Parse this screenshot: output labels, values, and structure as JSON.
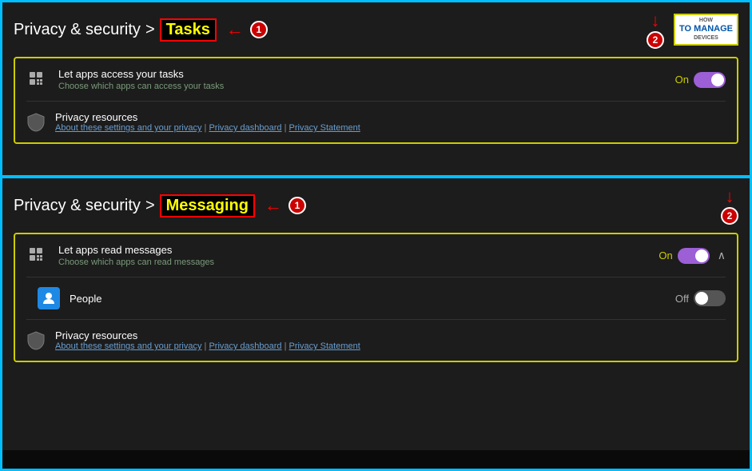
{
  "section1": {
    "breadcrumb": "Privacy & security",
    "sep": ">",
    "title": "Tasks",
    "badge1_label": "1",
    "badge2_label": "2",
    "setting": {
      "title": "Let apps access your tasks",
      "subtitle": "Choose which apps can access your tasks",
      "toggle_label": "On",
      "toggle_state": "on"
    },
    "privacy": {
      "title": "Privacy resources",
      "subtitle_about": "About these settings and your privacy",
      "subtitle_dashboard": "Privacy dashboard",
      "subtitle_statement": "Privacy Statement"
    }
  },
  "section2": {
    "breadcrumb": "Privacy & security",
    "sep": ">",
    "title": "Messaging",
    "badge1_label": "1",
    "badge2_label": "2",
    "setting": {
      "title": "Let apps read messages",
      "subtitle": "Choose which apps can read messages",
      "toggle_label": "On",
      "toggle_state": "on"
    },
    "people_app": {
      "name": "People",
      "toggle_label": "Off",
      "toggle_state": "off"
    },
    "privacy": {
      "title": "Privacy resources",
      "subtitle_about": "About these settings and your privacy",
      "subtitle_dashboard": "Privacy dashboard",
      "subtitle_statement": "Privacy Statement"
    }
  },
  "logo": {
    "line1": "HOW",
    "line2": "TO MANAGE",
    "line3": "DEVICES"
  }
}
